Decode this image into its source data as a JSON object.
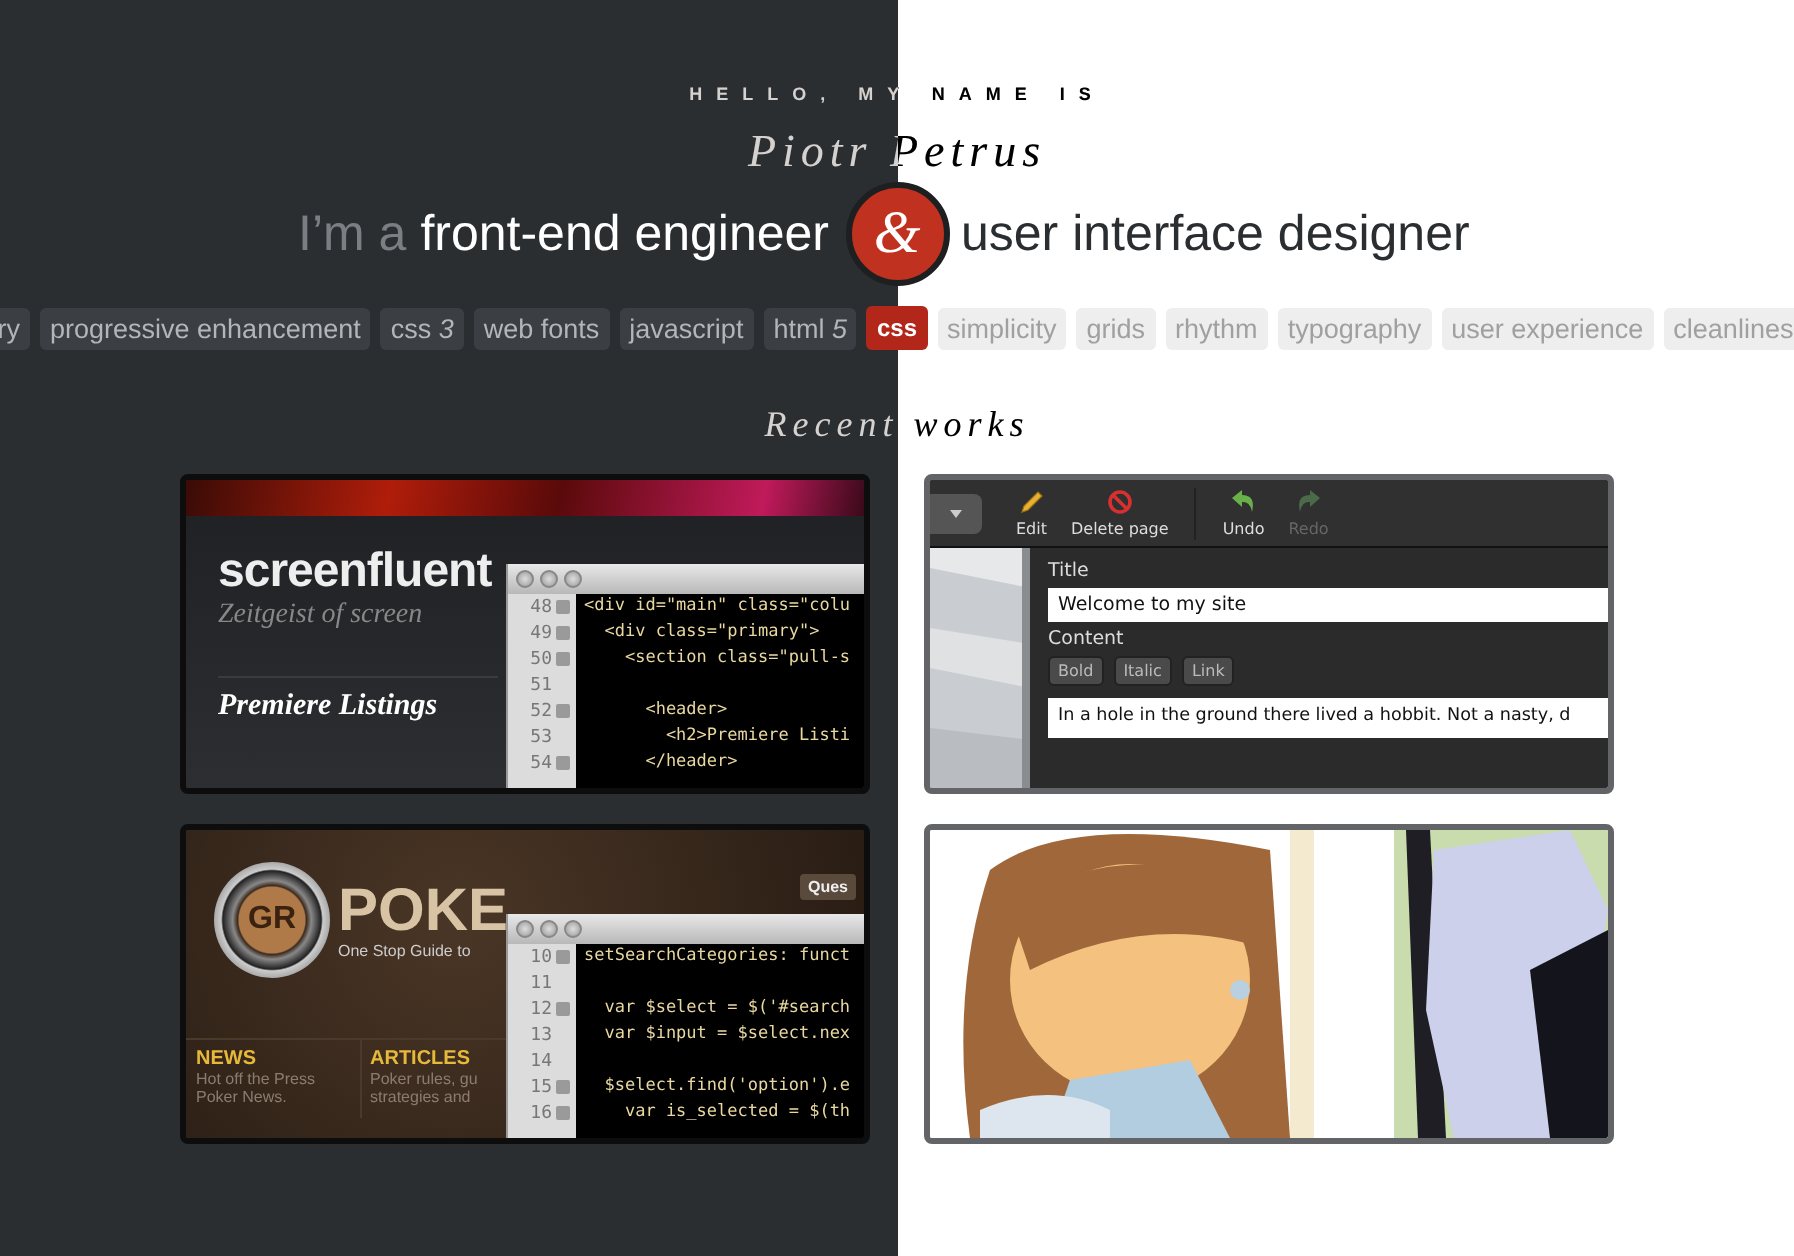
{
  "intro": "HELLO, MY NAME IS",
  "name": "Piotr Petrus",
  "headline": {
    "lead": "I’m a",
    "left_role": "front-end engineer",
    "connector": "&",
    "right_role": "user interface designer"
  },
  "tags": {
    "left": [
      "ry",
      "progressive enhancement",
      "css *3*",
      "web fonts",
      "javascript",
      "html *5*"
    ],
    "featured": "css",
    "right": [
      "simplicity",
      "grids",
      "rhythm",
      "typography",
      "user experience",
      "cleanlines"
    ]
  },
  "section_title": "Recent works",
  "works": [
    {
      "kind": "code_site",
      "logo": "screenfluent",
      "tagline": "Zeitgeist of screen",
      "heading": "Premiere Listings",
      "editor": [
        {
          "number": "48",
          "fold": true,
          "code": "<div id=\"main\" class=\"colu"
        },
        {
          "number": "49",
          "fold": true,
          "code": "  <div class=\"primary\">"
        },
        {
          "number": "50",
          "fold": true,
          "code": "    <section class=\"pull-s"
        },
        {
          "number": "51",
          "fold": false
        },
        {
          "number": "52",
          "fold": true,
          "code": "      <header>"
        },
        {
          "number": "53",
          "fold": false,
          "code": "        <h2>Premiere Listi"
        },
        {
          "number": "54",
          "fold": true,
          "code": "      </header>"
        }
      ]
    },
    {
      "kind": "cms",
      "toolbar": [
        {
          "label": "Edit",
          "disabled": false
        },
        {
          "label": "Delete page",
          "disabled": false
        },
        {
          "label": "Undo",
          "disabled": false
        },
        {
          "label": "Redo",
          "disabled": true
        }
      ],
      "title_label": "Title",
      "title_value": "Welcome to my site",
      "content_label": "Content",
      "format_buttons": [
        "Bold",
        "Italic",
        "Link"
      ],
      "content_text": "In a hole in the ground there lived a hobbit. Not a nasty, d"
    },
    {
      "kind": "poker",
      "chip": "GR",
      "logo": "POKE",
      "tagline": "One Stop Guide to",
      "tab": "Ques",
      "nav": [
        {
          "title": "NEWS",
          "lines": [
            "Hot off the Press",
            "Poker News."
          ]
        },
        {
          "title": "ARTICLES",
          "lines": [
            "Poker rules, gu",
            "strategies and"
          ]
        }
      ],
      "editor": [
        {
          "number": "10",
          "fold": true,
          "code": "setSearchCategories: funct"
        },
        {
          "number": "11",
          "fold": false
        },
        {
          "number": "12",
          "fold": true,
          "code": "  var $select = $('#search"
        },
        {
          "number": "13",
          "fold": false,
          "code": "  var $input = $select.nex"
        },
        {
          "number": "14",
          "fold": false
        },
        {
          "number": "15",
          "fold": true,
          "code": "  $select.find('option').e"
        },
        {
          "number": "16",
          "fold": true,
          "code": "    var is_selected = $(th"
        }
      ]
    },
    {
      "kind": "illustration"
    }
  ]
}
